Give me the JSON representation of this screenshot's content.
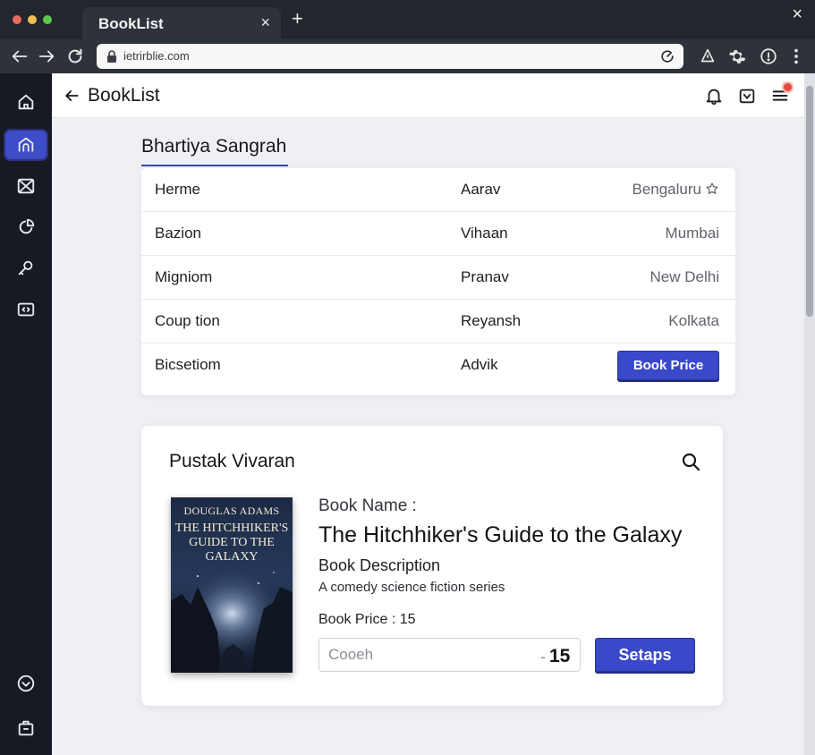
{
  "browser": {
    "tab_title": "BookList",
    "tab_close": "×",
    "new_tab": "+",
    "window_close": "×",
    "url": "ietrirblie.com"
  },
  "appbar": {
    "title": "BookList"
  },
  "book_list": {
    "title": "Bhartiya Sangrah",
    "rows": [
      {
        "name": "Herme",
        "author": "Aarav",
        "city": "Bengaluru"
      },
      {
        "name": "Bazion",
        "author": "Vihaan",
        "city": "Mumbai"
      },
      {
        "name": "Migniom",
        "author": "Pranav",
        "city": "New Delhi"
      },
      {
        "name": "Coup tion",
        "author": "Reyansh",
        "city": "Kolkata"
      },
      {
        "name": "Bicsetiom",
        "author": "Advik",
        "action": "Book Price"
      }
    ]
  },
  "detail": {
    "title": "Pustak Vivaran",
    "cover": {
      "author": "DOUGLAS ADAMS",
      "title": "THE HITCHHIKER'S GUIDE TO THE GALAXY"
    },
    "name_label": "Book Name :",
    "name_value": "The Hitchhiker's Guide to the Galaxy",
    "desc_label": "Book Description",
    "desc_value": "A comedy science fiction series",
    "price_label": "Book Price : 15",
    "coupon_placeholder": "Cooeh",
    "qty_dash": "-",
    "qty_value": "15",
    "submit_label": "Setaps"
  },
  "colors": {
    "accent": "#3a49c9",
    "rail_bg": "#171a22",
    "page_bg": "#eef0f4",
    "notification": "#e04a3f"
  }
}
